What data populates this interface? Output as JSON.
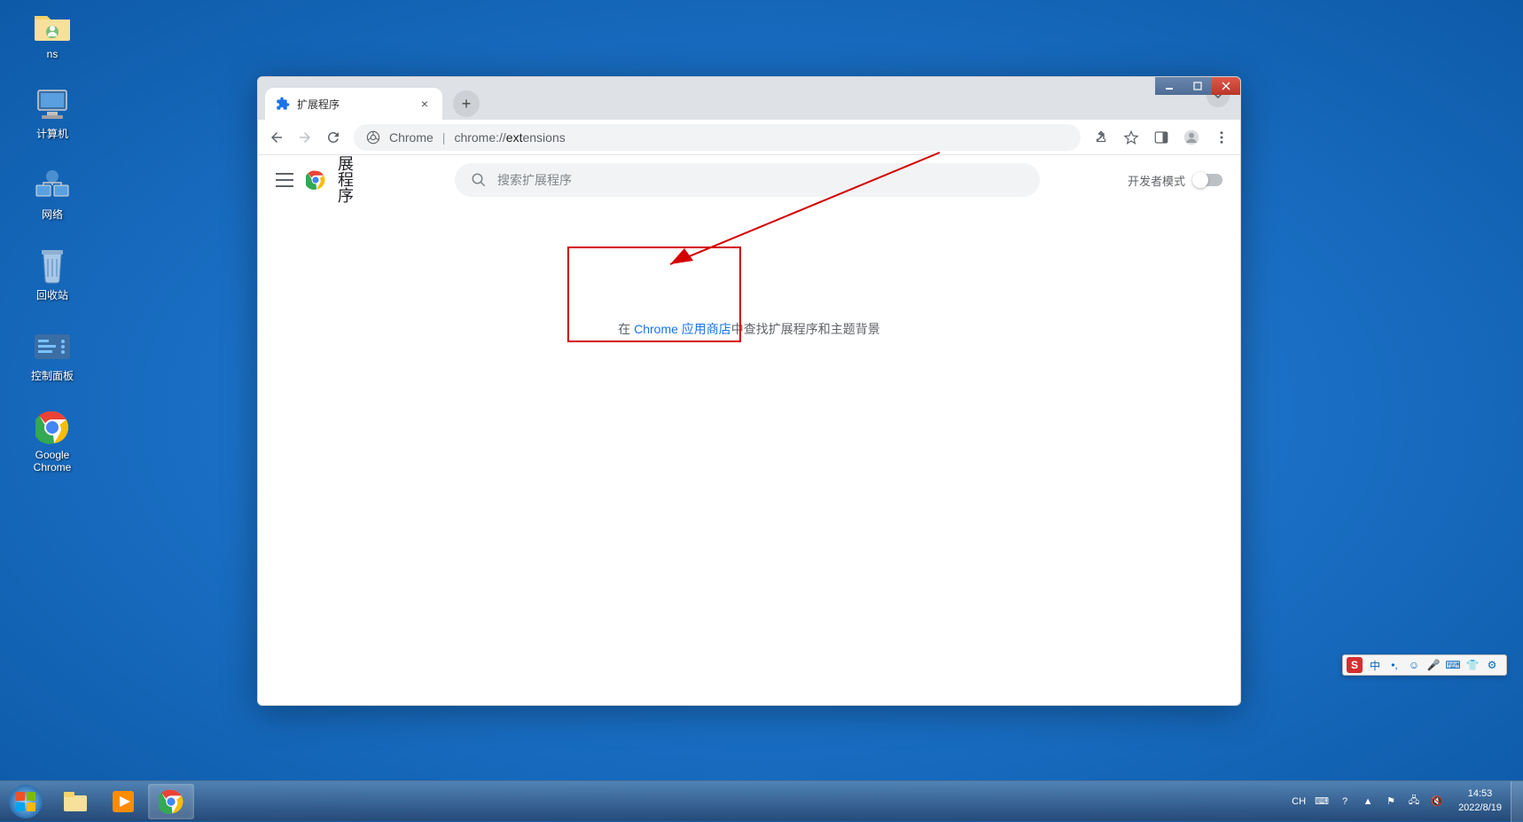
{
  "desktop": {
    "icons": [
      {
        "label": "ns"
      },
      {
        "label": "计算机"
      },
      {
        "label": "网络"
      },
      {
        "label": "回收站"
      },
      {
        "label": "控制面板"
      },
      {
        "label": "Google\nChrome"
      }
    ]
  },
  "chrome": {
    "tab": {
      "title": "扩展程序"
    },
    "url": {
      "scheme_label": "Chrome",
      "path_prefix": "chrome://",
      "path_bold": "ext",
      "path_rest": "ensions"
    },
    "header": {
      "title": "展\n程\n序",
      "search_placeholder": "搜索扩展程序",
      "dev_mode_label": "开发者模式"
    },
    "empty": {
      "prefix": "在 ",
      "link": "Chrome 应用商店",
      "suffix": "中查找扩展程序和主题背景"
    }
  },
  "taskbar": {
    "lang": "CH",
    "time": "14:53",
    "date": "2022/8/19"
  },
  "ime": {
    "label": "中"
  }
}
